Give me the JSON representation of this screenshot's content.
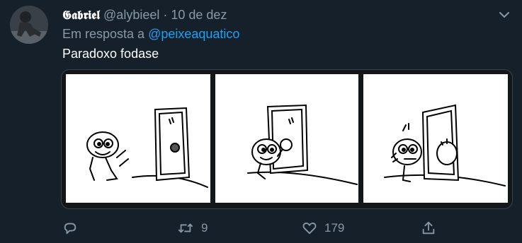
{
  "tweet": {
    "author_name": "𝕲𝖆𝖇𝖗𝖎𝖊𝖑",
    "handle": "@alybieel",
    "separator": "·",
    "date": "10 de dez",
    "reply_prefix": "Em resposta a",
    "reply_to": "@peixeaquatico",
    "text": "Paradoxo fodase"
  },
  "actions": {
    "retweet_count": "9",
    "like_count": "179"
  },
  "icons": {
    "reply": "reply-icon",
    "retweet": "retweet-icon",
    "like": "heart-icon",
    "share": "share-icon",
    "more": "chevron-down-icon"
  },
  "colors": {
    "background": "#15202b",
    "secondary_text": "#8899a6",
    "accent": "#1da1f2"
  }
}
